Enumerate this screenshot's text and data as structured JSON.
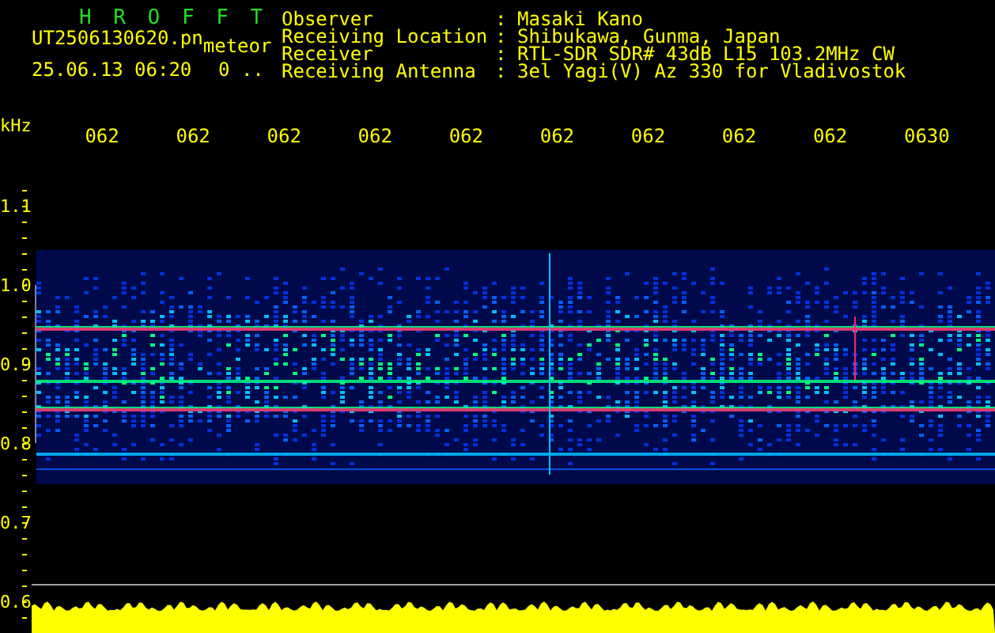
{
  "header": {
    "title": "H R O F F T",
    "filename": "UT2506130620.pn",
    "tag": "meteor",
    "datetime": "25.06.13 06:20",
    "count": "0 .."
  },
  "info": [
    {
      "label": "Observer",
      "separator": ":",
      "value": "Masaki Kano"
    },
    {
      "label": "Receiving Location",
      "separator": ":",
      "value": "Shibukawa, Gunma, Japan"
    },
    {
      "label": "Receiver",
      "separator": ":",
      "value": "RTL-SDR SDR# 43dB L15 103.2MHz CW"
    },
    {
      "label": "Receiving Antenna",
      "separator": ":",
      "value": "3el Yagi(V) Az 330 for Vladivostok"
    }
  ],
  "time_axis": {
    "labels": [
      "062",
      "062",
      "062",
      "062",
      "062",
      "062",
      "062",
      "062",
      "062",
      "0630"
    ]
  },
  "freq_axis": {
    "unit": "kHz",
    "labels": [
      "1.1",
      "1.0",
      "0.9",
      "0.8",
      "0.7",
      "0.6"
    ]
  }
}
